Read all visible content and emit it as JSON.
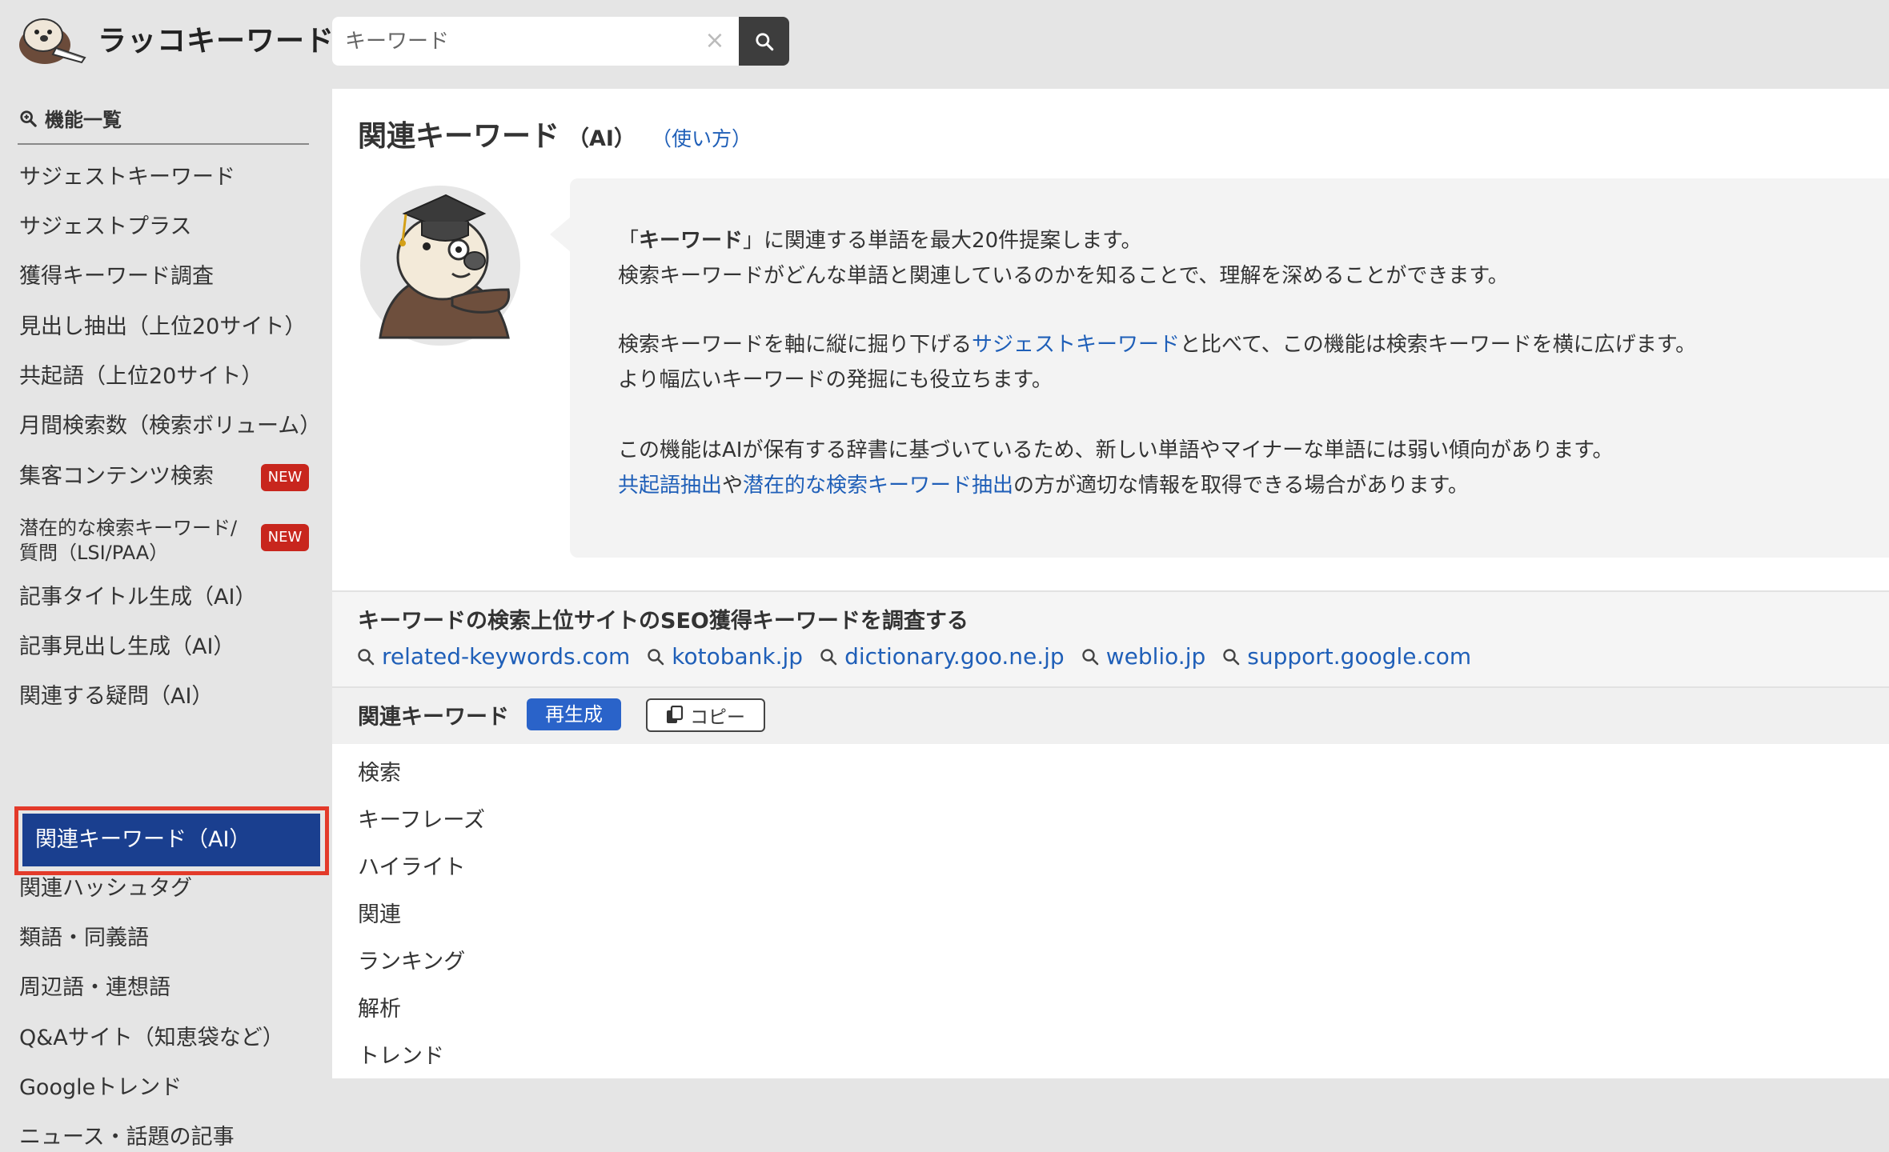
{
  "header": {
    "logo_text": "ラッコキーワード",
    "search_value": "",
    "search_placeholder": "キーワード"
  },
  "sidebar": {
    "heading": "機能一覧",
    "items": [
      {
        "label": "サジェストキーワード"
      },
      {
        "label": "サジェストプラス"
      },
      {
        "label": "獲得キーワード調査"
      },
      {
        "label": "見出し抽出（上位20サイト）"
      },
      {
        "label": "共起語（上位20サイト）"
      },
      {
        "label": "月間検索数（検索ボリューム）"
      },
      {
        "label": "集客コンテンツ検索",
        "badge": "NEW"
      },
      {
        "label": "潜在的な検索キーワード/質問（LSI/PAA）",
        "badge": "NEW"
      },
      {
        "label": "記事タイトル生成（AI）"
      },
      {
        "label": "記事見出し生成（AI）"
      },
      {
        "label": "関連する疑問（AI）"
      },
      {
        "label": "関連キーワード（AI）",
        "active": true
      },
      {
        "label": "関連ハッシュタグ"
      },
      {
        "label": "類語・同義語"
      },
      {
        "label": "周辺語・連想語"
      },
      {
        "label": "Q&Aサイト（知恵袋など）"
      },
      {
        "label": "Googleトレンド"
      },
      {
        "label": "ニュース・話題の記事"
      }
    ]
  },
  "main": {
    "title": "関連キーワード",
    "title_suffix": "（AI）",
    "usage_link": "（使い方）",
    "description": {
      "line1_open": "「",
      "line1_bold": "キーワード",
      "line1_rest": "」に関連する単語を最大20件提案します。",
      "line2": "検索キーワードがどんな単語と関連しているのかを知ることで、理解を深めることができます。",
      "line3_pre": "検索キーワードを軸に縦に掘り下げる",
      "line3_link": "サジェストキーワード",
      "line3_post": "と比べて、この機能は検索キーワードを横に広げます。",
      "line4": "より幅広いキーワードの発掘にも役立ちます。",
      "line5": "この機能はAIが保有する辞書に基づいているため、新しい単語やマイナーな単語には弱い傾向があります。",
      "line6_link1": "共起語抽出",
      "line6_mid": "や",
      "line6_link2": "潜在的な検索キーワード抽出",
      "line6_post": "の方が適切な情報を取得できる場合があります。"
    },
    "seo_section": {
      "title": "キーワードの検索上位サイトのSEO獲得キーワードを調査する",
      "sites": [
        "related-keywords.com",
        "kotobank.jp",
        "dictionary.goo.ne.jp",
        "weblio.jp",
        "support.google.com"
      ]
    },
    "keywords_bar": {
      "label": "関連キーワード",
      "regenerate_label": "再生成",
      "copy_label": "コピー"
    },
    "keywords": [
      "検索",
      "キーフレーズ",
      "ハイライト",
      "関連",
      "ランキング",
      "解析",
      "トレンド"
    ]
  },
  "colors": {
    "accent_link": "#1f5fb8",
    "active_nav": "#1a3f8f",
    "badge_red": "#c8261d",
    "highlight_frame": "#e33a2a",
    "regen_button": "#2a63c9"
  },
  "icons": [
    "otter-logo-icon",
    "clear-icon",
    "search-icon",
    "magnifier-plus-icon",
    "otter-professor-icon",
    "copy-icon"
  ]
}
